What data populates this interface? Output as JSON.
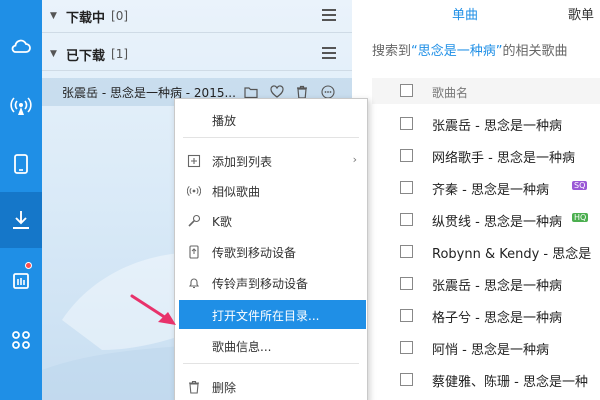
{
  "rail": {
    "items": [
      "cloud-icon",
      "broadcast-icon",
      "phone-device-icon",
      "download-icon",
      "grid-apps-icon",
      "radio-icon"
    ]
  },
  "downloads": {
    "downloading": {
      "title": "下载中",
      "count": "[0]"
    },
    "downloaded": {
      "title": "已下载",
      "count": "[1]"
    },
    "item": {
      "name": "张震岳 - 思念是一种病 - 2015..."
    }
  },
  "main": {
    "tabs": [
      "单曲",
      "歌单"
    ],
    "search": {
      "prefix": "搜索到",
      "keyword": "“思念是一种病”",
      "suffix": "的相关歌曲"
    },
    "column_header": "歌曲名",
    "songs": [
      {
        "title": "张震岳 - 思念是一种病",
        "tag": ""
      },
      {
        "title": "网络歌手 - 思念是一种病",
        "tag": ""
      },
      {
        "title": "齐秦 - 思念是一种病",
        "tag": "SQ"
      },
      {
        "title": "纵贯线 - 思念是一种病",
        "tag": "HQ"
      },
      {
        "title": "Robynn & Kendy - 思念是",
        "tag": ""
      },
      {
        "title": "张震岳 - 思念是一种病",
        "tag": ""
      },
      {
        "title": "格子兮 - 思念是一种病",
        "tag": ""
      },
      {
        "title": "阿悄 - 思念是一种病",
        "tag": ""
      },
      {
        "title": "蔡健雅、陈珊 - 思念是一种",
        "tag": ""
      }
    ],
    "tag_colors": {
      "SQ": "#9b59d6",
      "HQ": "#4caf50"
    }
  },
  "context_menu": {
    "items": [
      {
        "label": "播放",
        "icon": ""
      },
      {
        "label": "添加到列表",
        "icon": "add-box-icon",
        "submenu": true
      },
      {
        "label": "相似歌曲",
        "icon": "radio-waves-icon"
      },
      {
        "label": "K歌",
        "icon": "microphone-icon"
      },
      {
        "label": "传歌到移动设备",
        "icon": "device-upload-icon"
      },
      {
        "label": "传铃声到移动设备",
        "icon": "bell-icon"
      },
      {
        "label": "打开文件所在目录...",
        "icon": "",
        "highlighted": true
      },
      {
        "label": "歌曲信息...",
        "icon": ""
      },
      {
        "label": "删除",
        "icon": "trash-icon"
      }
    ]
  },
  "colors": {
    "accent": "#1f8fe6",
    "pointer": "#e8326b"
  }
}
